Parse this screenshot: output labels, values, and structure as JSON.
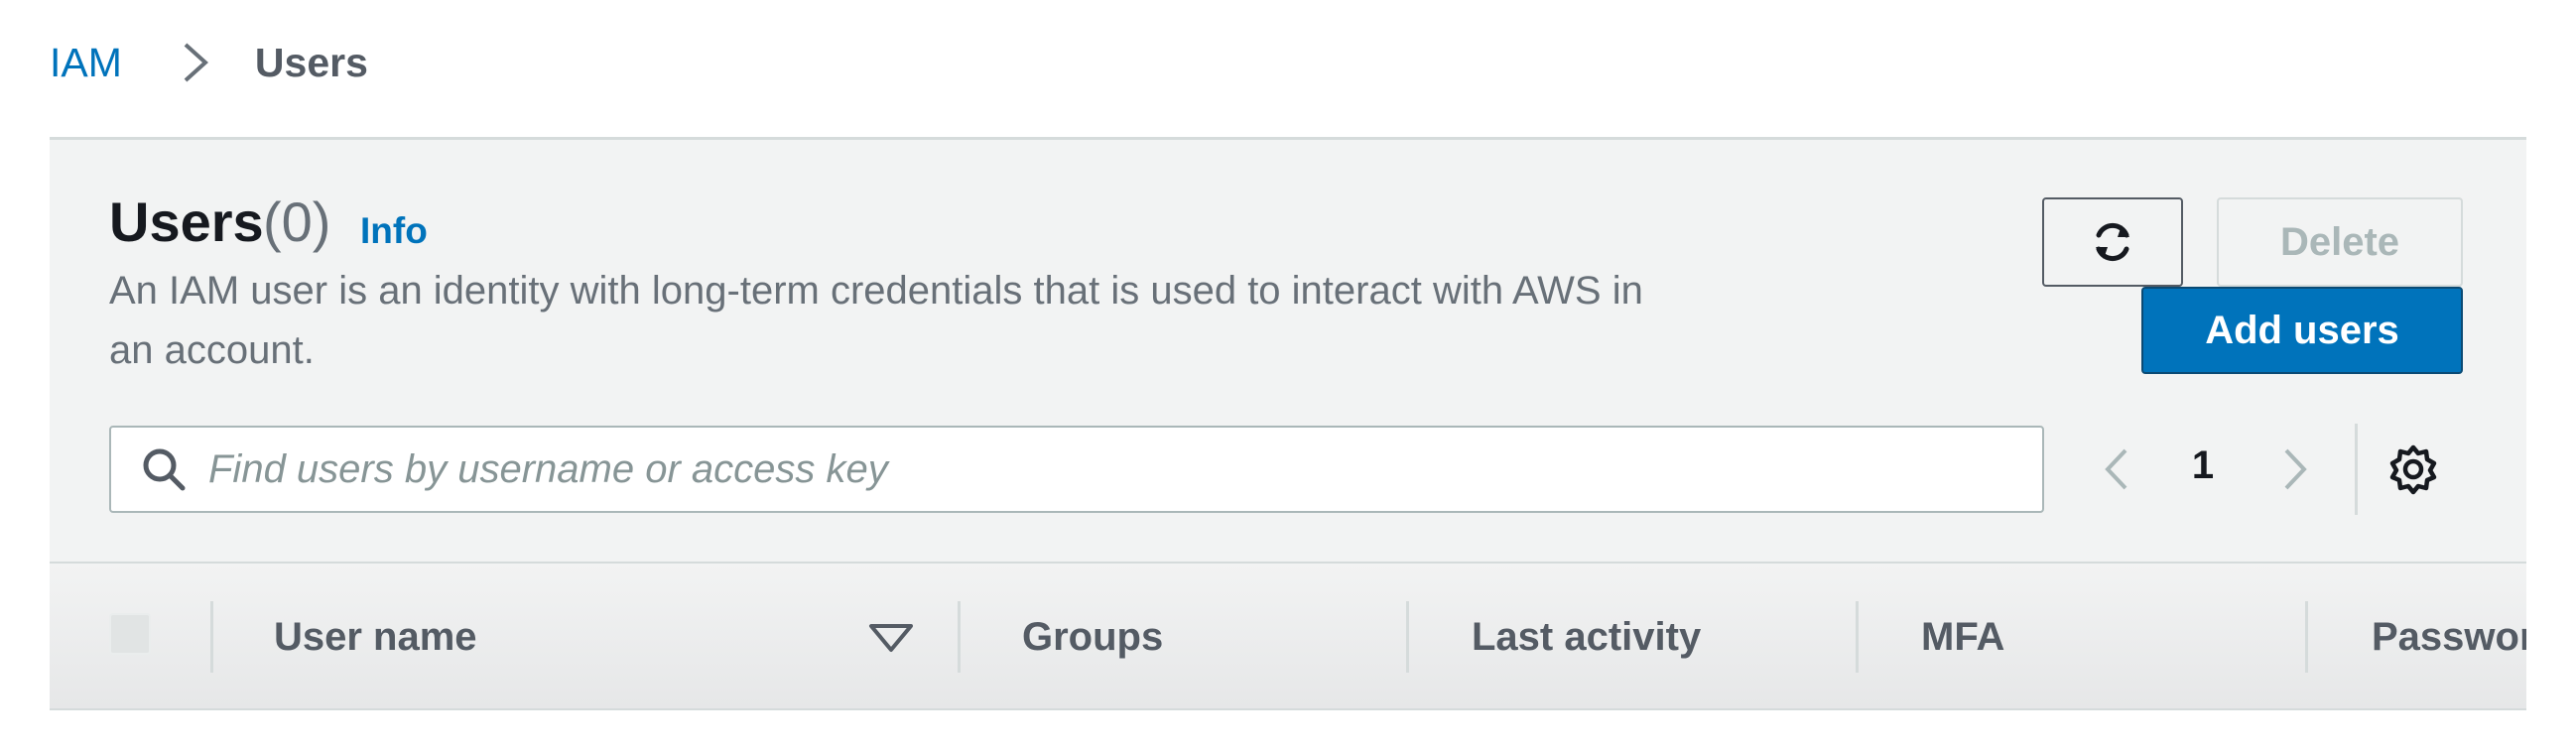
{
  "breadcrumb": {
    "root": "IAM",
    "current": "Users"
  },
  "header": {
    "title": "Users",
    "count": "(0)",
    "info_link": "Info",
    "description": "An IAM user is an identity with long-term credentials that is used to interact with AWS in an account."
  },
  "actions": {
    "refresh_icon": "refresh-icon",
    "delete_label": "Delete",
    "add_label": "Add users"
  },
  "search": {
    "placeholder": "Find users by username or access key",
    "value": ""
  },
  "pagination": {
    "current_page": "1"
  },
  "table": {
    "columns": [
      "User name",
      "Groups",
      "Last activity",
      "MFA",
      "Password age"
    ]
  },
  "colors": {
    "accent": "#0073bb",
    "primary_button": "#0073bb",
    "panel_bg": "#f2f3f3"
  }
}
